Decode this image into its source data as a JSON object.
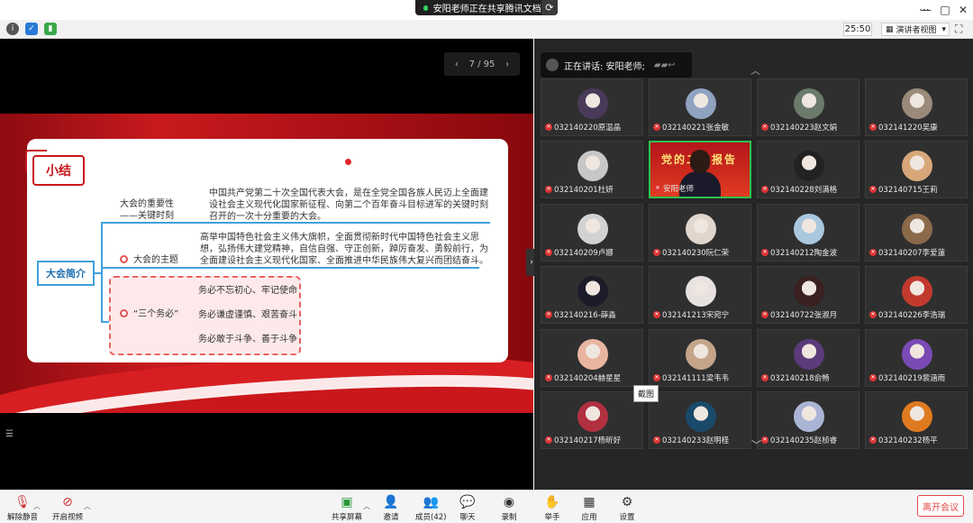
{
  "window": {
    "share_banner": "安阳老师正在共享腾讯文档",
    "minimize": "—",
    "maximize": "□",
    "close": "✕",
    "more": "···"
  },
  "toolbar": {
    "timer": "25:50",
    "view_mode": "演讲者视图"
  },
  "presentation": {
    "pager": "7 / 95",
    "tab_title": "小结",
    "intro_label": "大会简介",
    "branch1_label": "大会的重要性\n——关键时刻",
    "branch1_text": "中国共产党第二十次全国代表大会，是在全党全国各族人民迈上全面建设社会主义现代化国家新征程、向第二个百年奋斗目标进军的关键时刻召开的一次十分重要的大会。",
    "branch2_label": "大会的主题",
    "branch2_text": "高举中国特色社会主义伟大旗帜，全面贯彻新时代中国特色社会主义思想，弘扬伟大建党精神，自信自强、守正创新，踔厉奋发、勇毅前行，为全面建设社会主义现代化国家、全面推进中华民族伟大复兴而团结奋斗。",
    "branch3_label": "“三个务必”",
    "musts": [
      "务必不忘初心、牢记使命",
      "务必谦虚谨慎、艰苦奋斗",
      "务必敢于斗争、善于斗争"
    ]
  },
  "speaking": {
    "label": "正在讲话: 安阳老师;"
  },
  "participants": [
    {
      "name": "032140220原温晶",
      "color": "#4a3a5a"
    },
    {
      "name": "032140221张金敏",
      "color": "#8fa2c0"
    },
    {
      "name": "032140223赵文娟",
      "color": "#6b7a6a"
    },
    {
      "name": "032141220吴康",
      "color": "#9a8a7a"
    },
    {
      "name": "032140201杜妍",
      "color": "#c7c7c7"
    },
    {
      "name": "安阳老师",
      "color": "#c0141a",
      "teacher": true
    },
    {
      "name": "032140228刘满格",
      "color": "#222"
    },
    {
      "name": "032140715王莉",
      "color": "#d7a779"
    },
    {
      "name": "032140209卢娜",
      "color": "#d2d2d2"
    },
    {
      "name": "032140230阮仁荣",
      "color": "#e0d6ce"
    },
    {
      "name": "032140212陶金波",
      "color": "#a9c8de"
    },
    {
      "name": "032140207李爱蓮",
      "color": "#8b6a4a"
    },
    {
      "name": "032140216-薛淼",
      "color": "#1b1b2a"
    },
    {
      "name": "032141213宋宛宁",
      "color": "#e7e2e0"
    },
    {
      "name": "032140722张淑月",
      "color": "#3a2020"
    },
    {
      "name": "032140226李浩瑞",
      "color": "#c23a2e"
    },
    {
      "name": "032140204赫星星",
      "color": "#e8b5a0"
    },
    {
      "name": "032141111梁韦韦",
      "color": "#c4a58a"
    },
    {
      "name": "032140218俞畅",
      "color": "#5b3b7a"
    },
    {
      "name": "032140219裴涵雨",
      "color": "#7a4ab5"
    },
    {
      "name": "032140217杨昕好",
      "color": "#b03040"
    },
    {
      "name": "032140233赵明柽",
      "color": "#1a4a6a"
    },
    {
      "name": "032140235赵桢睿",
      "color": "#aab5d5"
    },
    {
      "name": "032140232杨平",
      "color": "#e07a20"
    }
  ],
  "tooltip": "截图",
  "bottom": {
    "unmute": "解除静音",
    "video": "开启视频",
    "share": "共享屏幕",
    "invite": "邀请",
    "members": "成员(42)",
    "chat": "聊天",
    "record": "录制",
    "raise": "举手",
    "apps": "应用",
    "settings": "设置",
    "leave": "离开会议"
  },
  "icons": [
    "mic-off-icon",
    "video-off-icon",
    "share-screen-icon",
    "invite-icon",
    "members-icon",
    "chat-icon",
    "record-icon",
    "hand-icon",
    "apps-icon",
    "gear-icon"
  ]
}
